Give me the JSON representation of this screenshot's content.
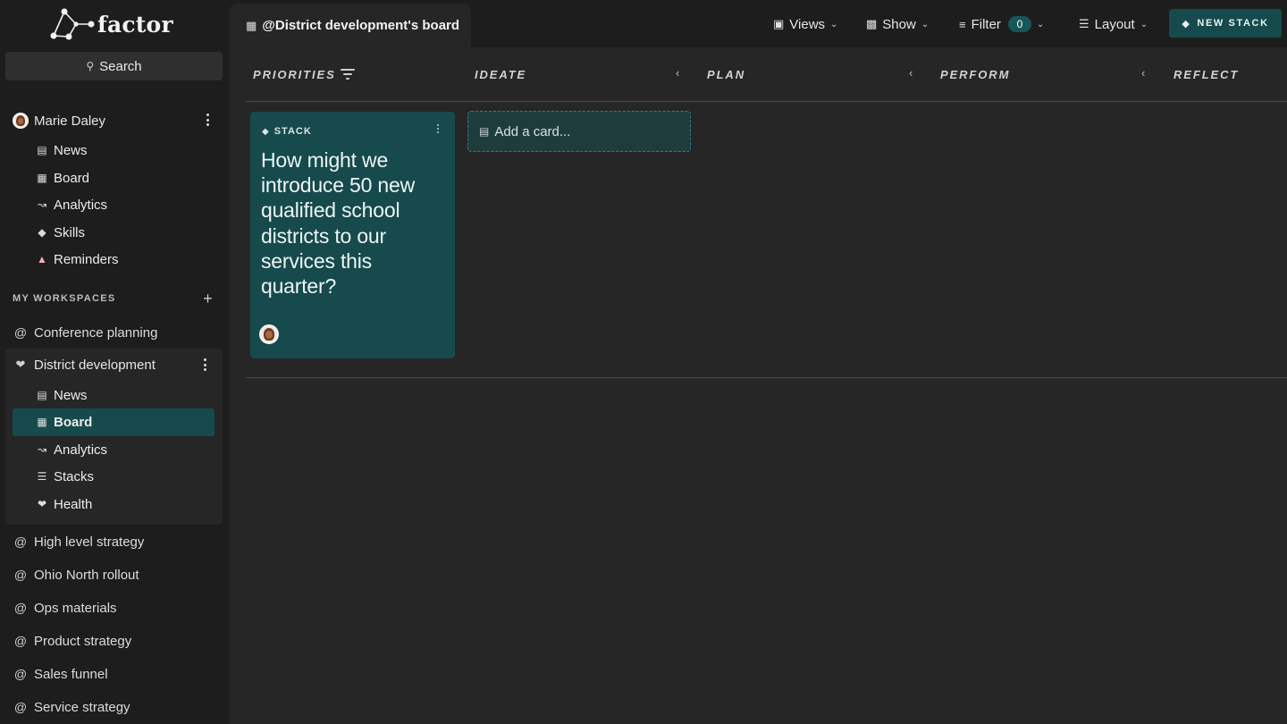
{
  "app": {
    "logo_text": "factor"
  },
  "search": {
    "label": "Search"
  },
  "user": {
    "name": "Marie Daley",
    "nav": [
      {
        "label": "News",
        "icon": "news-icon"
      },
      {
        "label": "Board",
        "icon": "board-icon"
      },
      {
        "label": "Analytics",
        "icon": "analytics-icon"
      },
      {
        "label": "Skills",
        "icon": "skills-icon"
      },
      {
        "label": "Reminders",
        "icon": "bell-icon"
      }
    ]
  },
  "workspaces": {
    "header": "MY WORKSPACES",
    "add_symbol": "+",
    "items_before": [
      {
        "label": "Conference planning"
      }
    ],
    "active": {
      "label": "District development",
      "nav": [
        {
          "label": "News",
          "icon": "news-icon"
        },
        {
          "label": "Board",
          "icon": "board-icon",
          "selected": true
        },
        {
          "label": "Analytics",
          "icon": "analytics-icon"
        },
        {
          "label": "Stacks",
          "icon": "stacks-icon"
        },
        {
          "label": "Health",
          "icon": "health-icon"
        }
      ]
    },
    "items_after": [
      {
        "label": "High level strategy"
      },
      {
        "label": "Ohio North rollout"
      },
      {
        "label": "Ops materials"
      },
      {
        "label": "Product strategy"
      },
      {
        "label": "Sales funnel"
      },
      {
        "label": "Service strategy"
      }
    ]
  },
  "topbar": {
    "tab_title": "@District development's board",
    "views": "Views",
    "show": "Show",
    "filter": "Filter",
    "filter_count": "0",
    "layout": "Layout",
    "new_stack": "NEW STACK"
  },
  "board": {
    "columns": [
      "PRIORITIES",
      "IDEATE",
      "PLAN",
      "PERFORM",
      "REFLECT"
    ],
    "card": {
      "type_label": "STACK",
      "title": "How might we introduce 50 new qualified school districts to our services this quarter?"
    },
    "add_card_label": "Add a card..."
  },
  "colors": {
    "sidebar_bg": "#1d1d1d",
    "main_bg": "#262626",
    "accent": "#164a4c",
    "badge": "#17575a"
  }
}
